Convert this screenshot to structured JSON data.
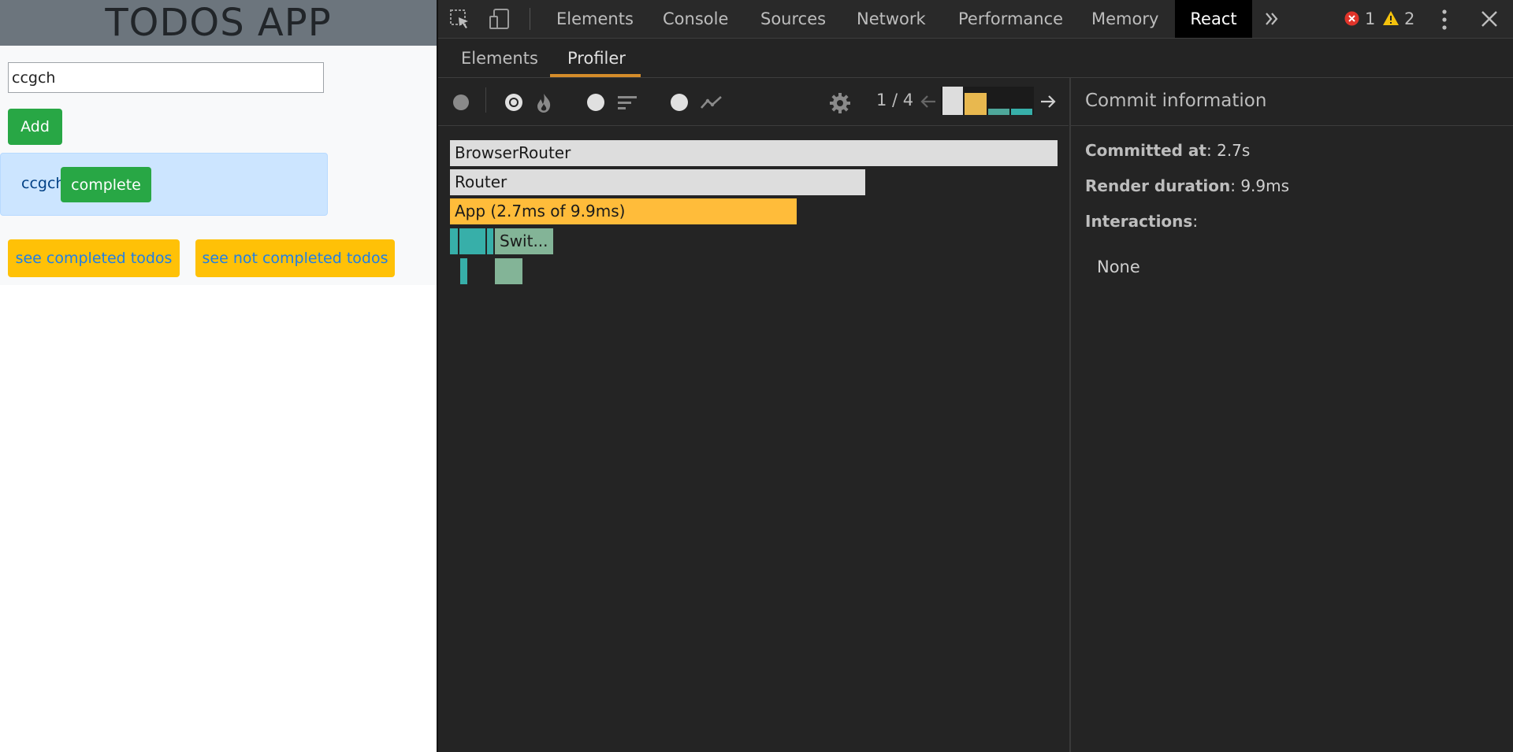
{
  "app": {
    "title": "TODOS APP",
    "input_value": "ccgch",
    "add_label": "Add",
    "todo_items": [
      {
        "text": "ccgch",
        "action_label": "complete"
      }
    ],
    "see_completed_label": "see completed todos",
    "see_not_completed_label": "see not completed todos"
  },
  "devtools": {
    "tabs": [
      "Elements",
      "Console",
      "Sources",
      "Network",
      "Performance",
      "Memory",
      "React"
    ],
    "active_tab": "React",
    "error_count": "1",
    "warning_count": "2",
    "react_subtabs": [
      "Elements",
      "Profiler"
    ],
    "active_subtab": "Profiler",
    "profiler": {
      "commit_counter": "1 / 4",
      "flamegraph": {
        "nodes": [
          {
            "label": "BrowserRouter"
          },
          {
            "label": "Router"
          },
          {
            "label": "App (2.7ms of 9.9ms)"
          },
          {
            "label": "Swit..."
          }
        ]
      },
      "commit_info": {
        "title": "Commit information",
        "committed_at_label": "Committed at",
        "committed_at_value": "2.7s",
        "render_duration_label": "Render duration",
        "render_duration_value": "9.9ms",
        "interactions_label": "Interactions",
        "interactions_value": "None"
      }
    }
  },
  "colors": {
    "app_header": "#6c757d",
    "success": "#28a745",
    "warning": "#ffc107",
    "link": "#1e7ee8",
    "info_bg": "#cce5ff",
    "devtools_bg": "#242424",
    "flame_yellow": "#ffbc3a",
    "flame_grey": "#dddddd",
    "flame_teal": "#37afa9",
    "flame_green": "#83b497",
    "error_red": "#e0342a",
    "warning_yellow": "#f4c20d",
    "active_underline": "#d48c2a"
  }
}
